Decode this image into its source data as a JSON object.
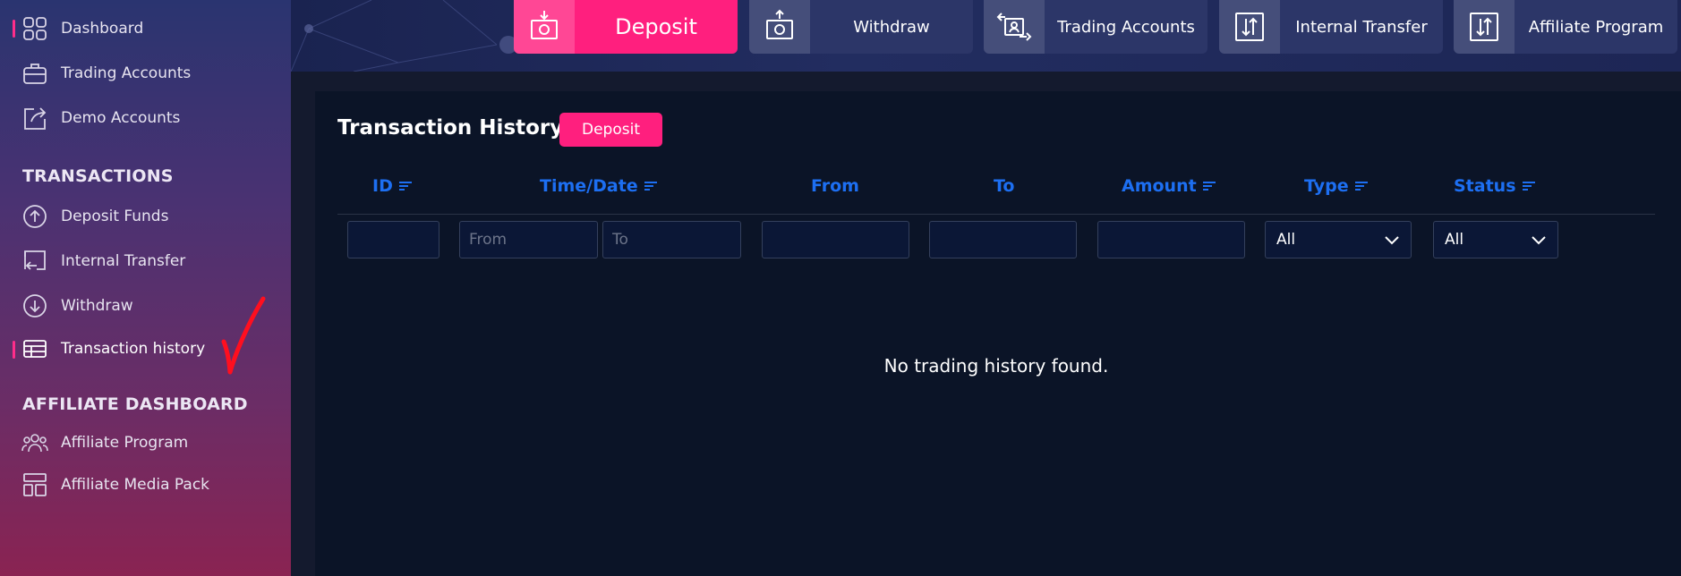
{
  "sidebar": {
    "items": [
      {
        "label": "Dashboard",
        "icon": "dashboard-icon"
      },
      {
        "label": "Trading Accounts",
        "icon": "briefcase-icon"
      },
      {
        "label": "Demo Accounts",
        "icon": "share-icon"
      }
    ],
    "transactions_heading": "TRANSACTIONS",
    "transactions": [
      {
        "label": "Deposit Funds",
        "icon": "arrow-up-circle-icon"
      },
      {
        "label": "Internal Transfer",
        "icon": "transfer-icon"
      },
      {
        "label": "Withdraw",
        "icon": "arrow-down-circle-icon"
      },
      {
        "label": "Transaction history",
        "icon": "table-icon"
      }
    ],
    "affiliate_heading": "AFFILIATE DASHBOARD",
    "affiliate": [
      {
        "label": "Affiliate Program",
        "icon": "users-icon"
      },
      {
        "label": "Affiliate Media Pack",
        "icon": "layout-icon"
      }
    ]
  },
  "topbar": {
    "buttons": [
      {
        "label": "Deposit",
        "icon": "deposit-icon"
      },
      {
        "label": "Withdraw",
        "icon": "withdraw-icon"
      },
      {
        "label": "Trading Accounts",
        "icon": "trading-accounts-icon"
      },
      {
        "label": "Internal Transfer",
        "icon": "internal-transfer-icon"
      },
      {
        "label": "Affiliate Program",
        "icon": "affiliate-program-icon"
      }
    ]
  },
  "panel": {
    "title": "Transaction History",
    "deposit_button": "Deposit",
    "columns": [
      "ID",
      "Time/Date",
      "From",
      "To",
      "Amount",
      "Type",
      "Status"
    ],
    "filters": {
      "date_from_placeholder": "From",
      "date_to_placeholder": "To",
      "type_value": "All",
      "status_value": "All"
    },
    "empty_message": "No trading history found."
  },
  "colors": {
    "accent_pink": "#ff1f7e",
    "column_blue": "#1d6ff2",
    "panel_bg": "#0b1427"
  }
}
